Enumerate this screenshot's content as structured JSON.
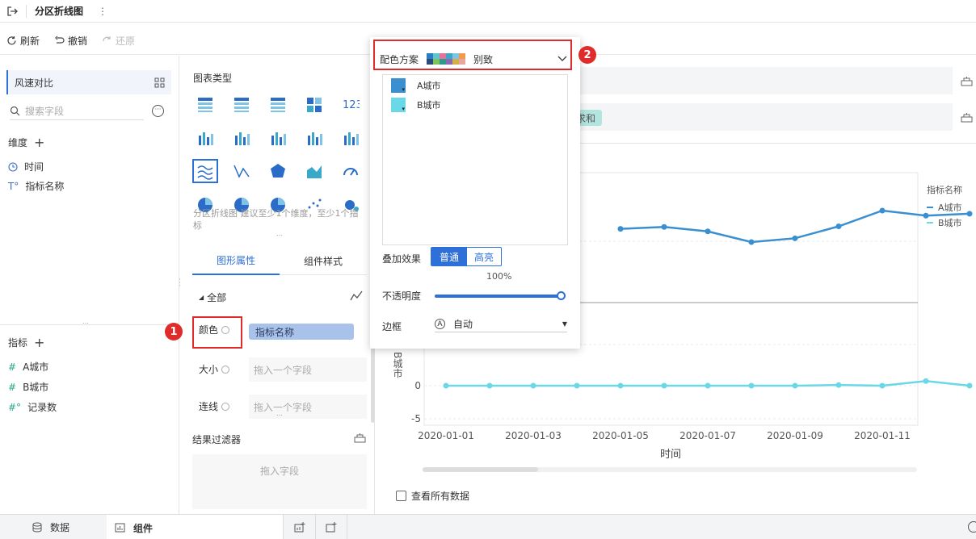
{
  "app": {
    "title": "分区折线图",
    "more": "⋮"
  },
  "toolbar": {
    "refresh": "刷新",
    "undo": "撤销",
    "redo": "还原"
  },
  "left": {
    "dataset": "风速对比",
    "search_placeholder": "搜索字段",
    "dimension_label": "维度",
    "dimensions": [
      "时间",
      "指标名称"
    ],
    "metric_label": "指标",
    "metrics": [
      "A城市",
      "B城市",
      "记录数"
    ]
  },
  "mid": {
    "chart_type_label": "图表类型",
    "chart_hint": "分区折线图 建议至少1个维度，至少1个指标",
    "tabs": [
      "图形属性",
      "组件样式"
    ],
    "all_label": "全部",
    "color_label": "颜色",
    "color_field": "指标名称",
    "size_label": "大小",
    "line_label": "连线",
    "drop_placeholder": "拖入一个字段",
    "filter_label": "结果过滤器",
    "filter_drop": "拖入字段"
  },
  "popup": {
    "scheme_label": "配色方案",
    "scheme_name": "别致",
    "series": [
      {
        "name": "A城市",
        "color": "#3a8fd0"
      },
      {
        "name": "B城市",
        "color": "#6ad8e6"
      }
    ],
    "overlay_label": "叠加效果",
    "overlay_normal": "普通",
    "overlay_bright": "高亮",
    "opacity_value": "100%",
    "opacity_label": "不透明度",
    "border_label": "边框",
    "border_value": "自动"
  },
  "chart": {
    "summary_chip": "求和",
    "y_label": "B城市",
    "x_label": "时间",
    "legend_title": "指标名称",
    "show_all": "查看所有数据"
  },
  "chart_data": {
    "type": "line",
    "x_ticks": [
      "2020-01-01",
      "2020-01-03",
      "2020-01-05",
      "2020-01-07",
      "2020-01-09",
      "2020-01-11"
    ],
    "xlabel": "时间",
    "lower_ylabel": "B城市",
    "lower_y_ticks": [
      "0",
      "-5"
    ],
    "legend_title": "指标名称",
    "series": [
      {
        "name": "A城市",
        "color": "#3a8fd0",
        "values": [
          null,
          null,
          null,
          null,
          12.1,
          12.4,
          11.7,
          10.0,
          10.6,
          12.5,
          15.0,
          14.2,
          14.5
        ]
      },
      {
        "name": "B城市",
        "color": "#6ad8e6",
        "values": [
          0,
          0,
          0,
          0,
          0,
          0,
          0,
          0,
          0,
          0.1,
          0,
          0.7,
          0
        ]
      }
    ]
  },
  "annotations": {
    "one": "1",
    "two": "2"
  },
  "bottom": {
    "tab_data": "数据",
    "tab_component": "组件"
  },
  "colors": {
    "accent": "#2e6fd8",
    "red": "#e02b2b"
  }
}
